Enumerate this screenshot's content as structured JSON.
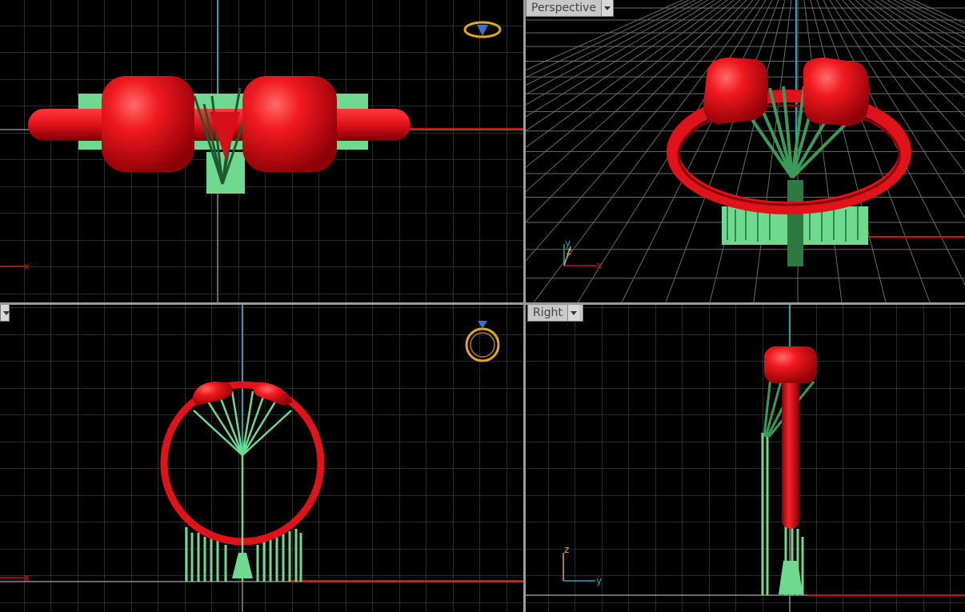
{
  "viewports": {
    "top": {
      "label": ""
    },
    "perspective": {
      "label": "Perspective"
    },
    "front": {
      "label": ""
    },
    "right": {
      "label": "Right"
    }
  },
  "axes": {
    "x": "x",
    "y": "y",
    "z": "z"
  },
  "colors": {
    "background": "#000000",
    "grid": "#555555",
    "grid_major": "#8a8a8a",
    "x_axis": "#cc1111",
    "y_axis": "#1aa7b8",
    "model_red": "#e8121a",
    "support_green": "#5fd98a",
    "gizmo_gold": "#e2a81c",
    "gizmo_blue": "#3b6fd8"
  },
  "icons": [
    "ring-gizmo-icon",
    "view-menu-dropdown-icon"
  ]
}
